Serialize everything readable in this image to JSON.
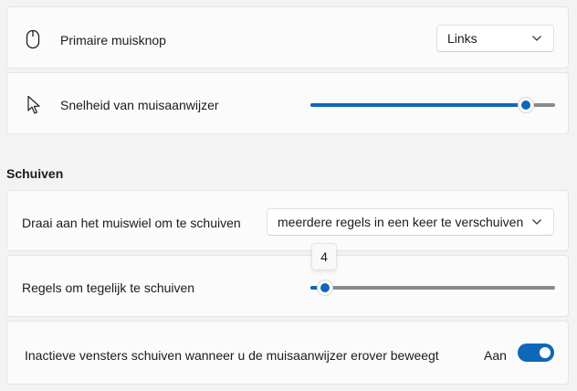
{
  "primary_button": {
    "label": "Primaire muisknop",
    "icon": "mouse-icon",
    "value": "Links"
  },
  "pointer_speed": {
    "label": "Snelheid van muisaanwijzer",
    "icon": "pointer-icon",
    "level": 0.88
  },
  "scroll_section": {
    "title": "Schuiven"
  },
  "scroll_wheel": {
    "label": "Draai aan het muiswiel om te schuiven",
    "value": "meerdere regels in een keer te verschuiven"
  },
  "lines_to_scroll": {
    "label": "Regels om tegelijk te schuiven",
    "value": "4",
    "level": 0.06
  },
  "inactive_scroll": {
    "label": "Inactieve vensters schuiven wanneer u de muisaanwijzer erover beweegt",
    "state": "Aan",
    "on": true
  },
  "colors": {
    "accent": "#0f67b8",
    "background": "#f3f3f3",
    "card": "#fbfbfb"
  }
}
